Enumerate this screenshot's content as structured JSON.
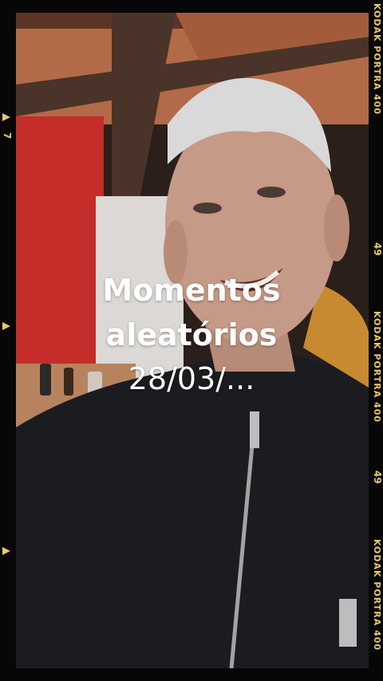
{
  "caption": {
    "line1": "Momentos",
    "line2": "aleatórios",
    "line3": "28/03/..."
  },
  "film_edge": {
    "brand_a": "KODAK PORTRA 400",
    "brand_b": "KODAK PORTRA 400",
    "brand_c": "KODAK PORTRA 400",
    "frame_a": "49",
    "frame_b": "49",
    "frame_c": "7",
    "color": "#e9c76a"
  }
}
